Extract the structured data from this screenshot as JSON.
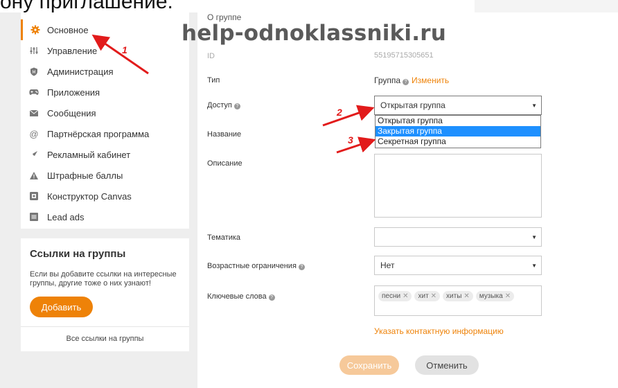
{
  "caption": "ону приглашение.",
  "watermark": "help-odnoklassniki.ru",
  "sidebar": {
    "items": [
      {
        "label": "Основное",
        "icon": "gear-icon"
      },
      {
        "label": "Управление",
        "icon": "sliders-icon"
      },
      {
        "label": "Администрация",
        "icon": "shield-icon"
      },
      {
        "label": "Приложения",
        "icon": "gamepad-icon"
      },
      {
        "label": "Сообщения",
        "icon": "envelope-icon"
      },
      {
        "label": "Партнёрская программа",
        "icon": "at-icon"
      },
      {
        "label": "Рекламный кабинет",
        "icon": "megaphone-icon"
      },
      {
        "label": "Штрафные баллы",
        "icon": "warning-icon"
      },
      {
        "label": "Конструктор Canvas",
        "icon": "canvas-icon"
      },
      {
        "label": "Lead ads",
        "icon": "list-icon"
      }
    ]
  },
  "links_card": {
    "title": "Ссылки на группы",
    "text": "Если вы добавите ссылки на интересные группы, другие тоже о них узнают!",
    "add_label": "Добавить",
    "all_links_label": "Все ссылки на группы"
  },
  "form": {
    "section_title": "О группе",
    "id_label": "ID",
    "id_value": "55195715305651",
    "type_label": "Тип",
    "type_value": "Группа",
    "type_change": "Изменить",
    "access_label": "Доступ",
    "access_value": "Открытая группа",
    "access_options": [
      "Открытая группа",
      "Закрытая группа",
      "Секретная группа"
    ],
    "access_highlighted": "Закрытая группа",
    "name_label": "Название",
    "description_label": "Описание",
    "topic_label": "Тематика",
    "topic_value": "",
    "age_label": "Возрастные ограничения",
    "age_value": "Нет",
    "keywords_label": "Ключевые слова",
    "keywords": [
      "песни",
      "хит",
      "хиты",
      "музыка"
    ],
    "contact_link": "Указать контактную информацию",
    "save_label": "Сохранить",
    "cancel_label": "Отменить"
  },
  "annotations": [
    "1",
    "2",
    "3"
  ],
  "colors": {
    "accent": "#ee8208",
    "arrow": "#e21b1b",
    "highlight": "#1e90ff"
  }
}
